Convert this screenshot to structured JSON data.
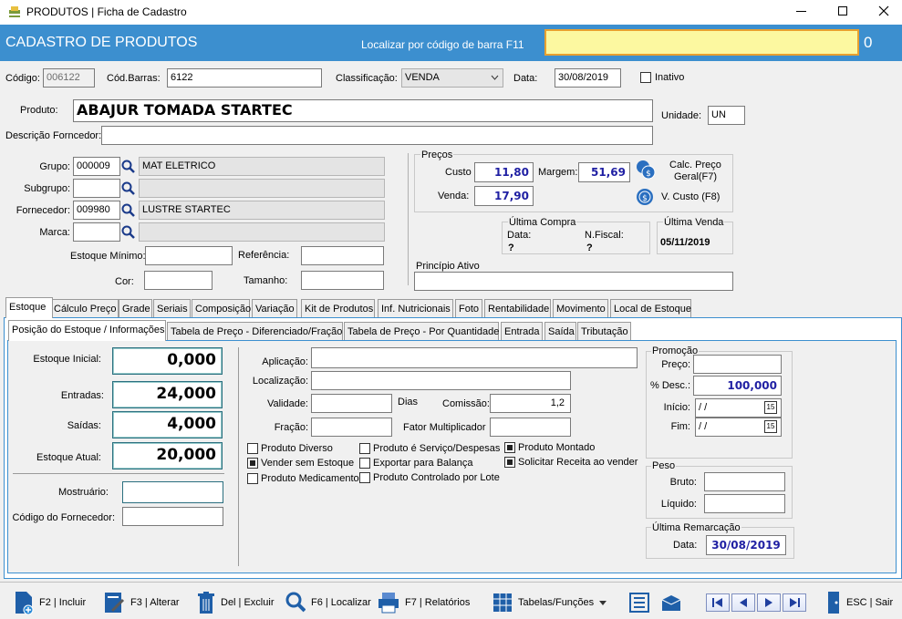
{
  "window": {
    "title": "PRODUTOS | Ficha de Cadastro"
  },
  "header": {
    "title": "CADASTRO DE PRODUTOS",
    "barcode_label": "Localizar por código de barra F11",
    "barcode_value": "",
    "count": "0"
  },
  "top": {
    "codigo_label": "Código:",
    "codigo": "006122",
    "codbarras_label": "Cód.Barras:",
    "codbarras": "6122",
    "classificacao_label": "Classificação:",
    "classificacao": "VENDA",
    "data_label": "Data:",
    "data": "30/08/2019",
    "inativo_label": "Inativo"
  },
  "produto": {
    "label": "Produto:",
    "value": "ABAJUR TOMADA STARTEC",
    "unidade_label": "Unidade:",
    "unidade": "UN",
    "descricao_label": "Descrição Forncedor:",
    "descricao": ""
  },
  "classif": {
    "grupo_label": "Grupo:",
    "grupo_code": "000009",
    "grupo_name": "MAT ELETRICO",
    "subgrupo_label": "Subgrupo:",
    "subgrupo_code": "",
    "subgrupo_name": "",
    "fornecedor_label": "Fornecedor:",
    "fornecedor_code": "009980",
    "fornecedor_name": "LUSTRE STARTEC",
    "marca_label": "Marca:",
    "marca_code": "",
    "marca_name": "",
    "estoque_min_label": "Estoque Mínimo:",
    "referencia_label": "Referência:",
    "cor_label": "Cor:",
    "tamanho_label": "Tamanho:"
  },
  "precos": {
    "legend": "Preços",
    "custo_label": "Custo",
    "custo": "11,80",
    "margem_label": "Margem:",
    "margem": "51,69",
    "venda_label": "Venda:",
    "venda": "17,90",
    "calc_label1": "Calc. Preço",
    "calc_label2": "Geral(F7)",
    "vcusto_label": "V. Custo (F8)"
  },
  "ultima_compra": {
    "legend": "Última Compra",
    "data_label": "Data:",
    "data": "?",
    "nf_label": "N.Fiscal:",
    "nf": "?"
  },
  "ultima_venda": {
    "legend": "Última Venda",
    "data": "05/11/2019"
  },
  "principio": {
    "label": "Princípio Ativo",
    "value": ""
  },
  "tabs": [
    "Estoque",
    "Cálculo Preço",
    "Grade",
    "Seriais",
    "Composição",
    "Variação",
    "Kit de Produtos",
    "Inf. Nutricionais",
    "Foto",
    "Rentabilidade",
    "Movimento",
    "Local de Estoque"
  ],
  "subtabs": [
    "Posição do Estoque / Informações",
    "Tabela de Preço - Diferenciado/Fração",
    "Tabela de Preço - Por Quantidade",
    "Entrada",
    "Saída",
    "Tributação"
  ],
  "estoque": {
    "inicial_label": "Estoque Inicial:",
    "inicial": "0,000",
    "entradas_label": "Entradas:",
    "entradas": "24,000",
    "saidas_label": "Saídas:",
    "saidas": "4,000",
    "atual_label": "Estoque Atual:",
    "atual": "20,000",
    "mostruario_label": "Mostruário:",
    "codforn_label": "Código do Fornecedor:"
  },
  "info": {
    "aplicacao_label": "Aplicação:",
    "localizacao_label": "Localização:",
    "validade_label": "Validade:",
    "dias_label": "Dias",
    "comissao_label": "Comissão:",
    "comissao": "1,2",
    "fracao_label": "Fração:",
    "fator_label": "Fator Multiplicador"
  },
  "checks": [
    {
      "label": "Produto Diverso",
      "on": false
    },
    {
      "label": "Produto é Serviço/Despesas",
      "on": false
    },
    {
      "label": "Produto Montado",
      "on": true
    },
    {
      "label": "Vender sem Estoque",
      "on": true
    },
    {
      "label": "Exportar para Balança",
      "on": false
    },
    {
      "label": "Solicitar Receita ao vender",
      "on": true
    },
    {
      "label": "Produto Medicamento",
      "on": false
    },
    {
      "label": "Produto Controlado por Lote",
      "on": false
    }
  ],
  "promocao": {
    "legend": "Promoção",
    "preco_label": "Preço:",
    "desc_label": "% Desc.:",
    "desc": "100,000",
    "inicio_label": "Início:",
    "inicio": " / /",
    "fim_label": "Fim:",
    "fim": " / /",
    "cal_glyph": "15"
  },
  "peso": {
    "legend": "Peso",
    "bruto_label": "Bruto:",
    "liquido_label": "Líquido:"
  },
  "remarcacao": {
    "legend": "Última Remarcação",
    "data_label": "Data:",
    "data": "30/08/2019"
  },
  "toolbar": {
    "incluir": "F2 | Incluir",
    "alterar": "F3 | Alterar",
    "excluir": "Del | Excluir",
    "localizar": "F6 | Localizar",
    "relatorios": "F7 | Relatórios",
    "tabelas": "Tabelas/Funções",
    "sair": "ESC | Sair"
  }
}
